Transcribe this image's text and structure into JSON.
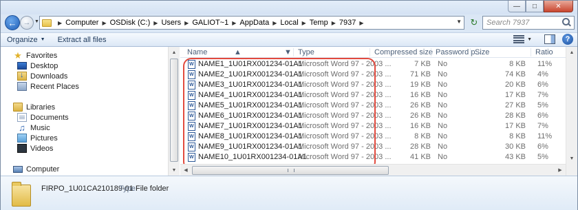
{
  "breadcrumbs": [
    "Computer",
    "OSDisk (C:)",
    "Users",
    "GALIOT~1",
    "AppData",
    "Local",
    "Temp",
    "7937"
  ],
  "search": {
    "placeholder": "Search 7937"
  },
  "toolbar": {
    "organize_label": "Organize",
    "extract_label": "Extract all files"
  },
  "nav": {
    "favorites_label": "Favorites",
    "favorites": [
      "Desktop",
      "Downloads",
      "Recent Places"
    ],
    "libraries_label": "Libraries",
    "libraries": [
      "Documents",
      "Music",
      "Pictures",
      "Videos"
    ],
    "computer_label": "Computer"
  },
  "columns": {
    "name": "Name",
    "type": "Type",
    "compressed": "Compressed size",
    "password": "Password p...",
    "size": "Size",
    "ratio": "Ratio"
  },
  "files": [
    {
      "name": "NAME1_1U01RX001234-01A1",
      "type": "Microsoft Word 97 - 2003 ...",
      "compressed": "7 KB",
      "password": "No",
      "size": "8 KB",
      "ratio": "11%"
    },
    {
      "name": "NAME2_1U01RX001234-01A1",
      "type": "Microsoft Word 97 - 2003 ...",
      "compressed": "71 KB",
      "password": "No",
      "size": "74 KB",
      "ratio": "4%"
    },
    {
      "name": "NAME3_1U01RX001234-01A1",
      "type": "Microsoft Word 97 - 2003 ...",
      "compressed": "19 KB",
      "password": "No",
      "size": "20 KB",
      "ratio": "6%"
    },
    {
      "name": "NAME4_1U01RX001234-01A1",
      "type": "Microsoft Word 97 - 2003 ...",
      "compressed": "16 KB",
      "password": "No",
      "size": "17 KB",
      "ratio": "7%"
    },
    {
      "name": "NAME5_1U01RX001234-01A1",
      "type": "Microsoft Word 97 - 2003 ...",
      "compressed": "26 KB",
      "password": "No",
      "size": "27 KB",
      "ratio": "5%"
    },
    {
      "name": "NAME6_1U01RX001234-01A1",
      "type": "Microsoft Word 97 - 2003 ...",
      "compressed": "26 KB",
      "password": "No",
      "size": "28 KB",
      "ratio": "6%"
    },
    {
      "name": "NAME7_1U01RX001234-01A1",
      "type": "Microsoft Word 97 - 2003 ...",
      "compressed": "16 KB",
      "password": "No",
      "size": "17 KB",
      "ratio": "7%"
    },
    {
      "name": "NAME8_1U01RX001234-01A1",
      "type": "Microsoft Word 97 - 2003 ...",
      "compressed": "8 KB",
      "password": "No",
      "size": "8 KB",
      "ratio": "11%"
    },
    {
      "name": "NAME9_1U01RX001234-01A1",
      "type": "Microsoft Word 97 - 2003 ...",
      "compressed": "28 KB",
      "password": "No",
      "size": "30 KB",
      "ratio": "6%"
    },
    {
      "name": "NAME10_1U01RX001234-01A1",
      "type": "Microsoft Word 97 - 2003 ...",
      "compressed": "41 KB",
      "password": "No",
      "size": "43 KB",
      "ratio": "5%"
    }
  ],
  "details": {
    "name": "FIRPO_1U01CA210189-01",
    "type_label": "Type:",
    "type_value": "File folder"
  },
  "colors": {
    "highlight": "#e24a3e",
    "accent": "#1e395b"
  },
  "icons": {
    "back": "back-arrow-icon",
    "forward": "forward-arrow-icon",
    "refresh": "refresh-icon",
    "search": "search-icon",
    "views": "views-icon",
    "preview": "preview-pane-icon",
    "help": "help-icon"
  }
}
